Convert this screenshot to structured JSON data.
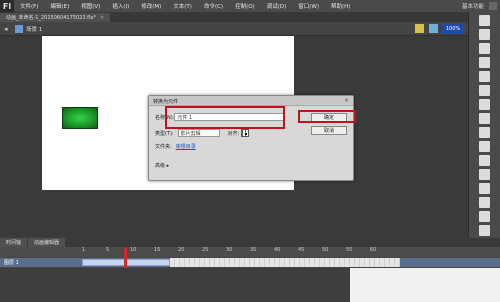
{
  "app": {
    "logo": "Fl"
  },
  "menu": {
    "items": [
      "文件(F)",
      "编辑(E)",
      "视图(V)",
      "插入(I)",
      "修改(M)",
      "文本(T)",
      "命令(C)",
      "控制(O)",
      "调试(D)",
      "窗口(W)",
      "帮助(H)"
    ],
    "workspace": "基本功能"
  },
  "tab": {
    "title": "动画_未命名-1_20150604175023.fla*",
    "close": "×"
  },
  "editbar": {
    "scene": "场景 1",
    "zoom": "100%"
  },
  "dialog": {
    "title": "转换为元件",
    "name_label": "名称(N):",
    "name_value": "元件 1",
    "type_label": "类型(T):",
    "type_value": "影片剪辑",
    "reg_label": "对齐:",
    "folder_label": "文件夹:",
    "folder_value": "库根目录",
    "advanced": "高级 ▸",
    "ok": "确定",
    "cancel": "取消",
    "close": "×"
  },
  "timeline": {
    "tabs": [
      "时间轴",
      "动画编辑器"
    ],
    "frames": [
      "1",
      "5",
      "10",
      "15",
      "20",
      "25",
      "30",
      "35",
      "40",
      "45",
      "50",
      "55",
      "60"
    ],
    "layer": "图层 1"
  }
}
